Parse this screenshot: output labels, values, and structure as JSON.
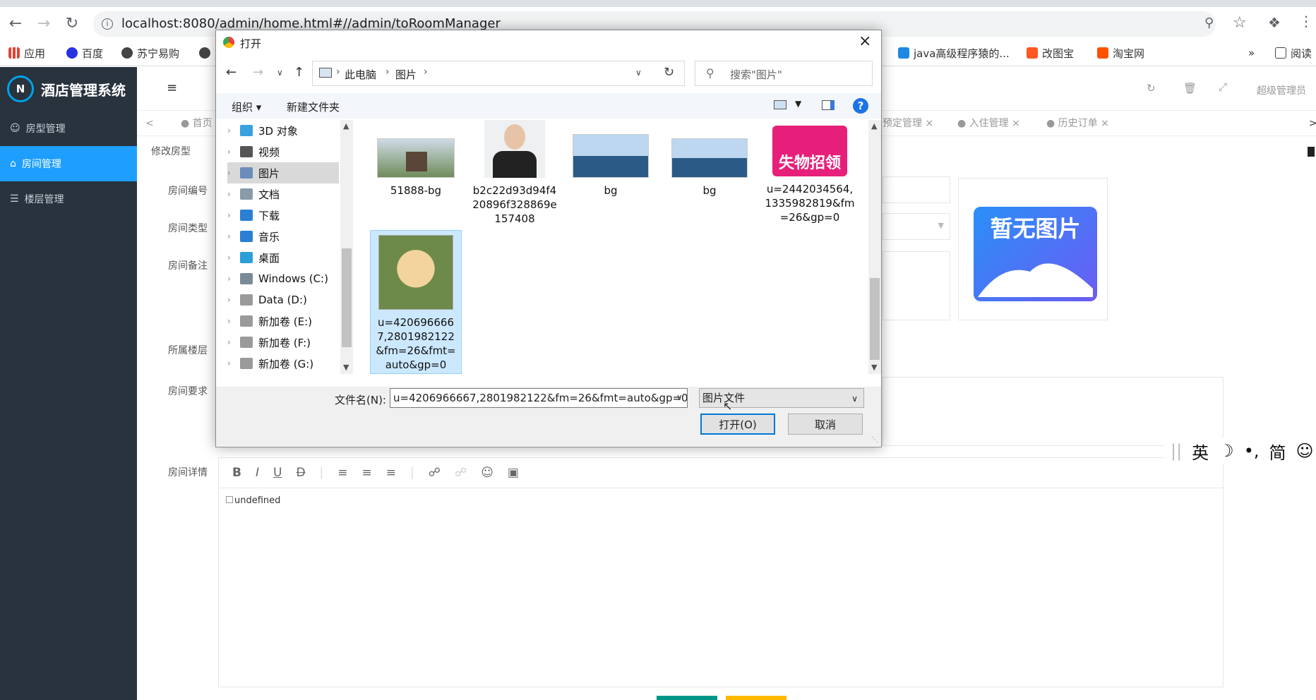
{
  "browser": {
    "url": "localhost:8080/admin/home.html#//admin/toRoomManager",
    "bookmarks": [
      {
        "label": "应用",
        "color": "#e94235"
      },
      {
        "label": "百度",
        "color": "#2932e1"
      },
      {
        "label": "苏宁易购",
        "color": "#444444"
      },
      {
        "label": "java高级程序猿的...",
        "color": "#1e88e5"
      },
      {
        "label": "改图宝",
        "color": "#ff5722"
      },
      {
        "label": "淘宝网",
        "color": "#ff5000"
      },
      {
        "label": "阅读",
        "color": "#444444"
      }
    ],
    "bookmarks_more": "»"
  },
  "app": {
    "brand": "酒店管理系统",
    "brand_logo_letter": "N",
    "menu": [
      {
        "label": "房型管理",
        "icon": "users-icon",
        "active": false
      },
      {
        "label": "房间管理",
        "icon": "home-icon",
        "active": true
      },
      {
        "label": "楼层管理",
        "icon": "list-icon",
        "active": false
      }
    ],
    "user": "超级管理员",
    "tabs": [
      {
        "label": "首页"
      },
      {
        "label": "预定管理"
      },
      {
        "label": "入住管理"
      },
      {
        "label": "历史订单"
      }
    ],
    "subtitle": "修改房型",
    "form_labels": {
      "number": "房间编号",
      "type": "房间类型",
      "remark": "房间备注",
      "floor": "所属楼层",
      "requirement": "房间要求",
      "detail": "房间详情"
    },
    "no_image_text": "暂无图片",
    "editor_content": "undefined",
    "accent": "#1e9fff",
    "sidebar_bg": "#28333e"
  },
  "ime": {
    "items": [
      "英",
      "☽",
      "•,",
      "简",
      "☺"
    ]
  },
  "dialog": {
    "title": "打开",
    "breadcrumb": [
      "此电脑",
      "图片"
    ],
    "search_placeholder": "搜索\"图片\"",
    "organize": "组织 ▾",
    "new_folder": "新建文件夹",
    "tree": [
      {
        "label": "3D 对象",
        "color": "#3aa0e0",
        "selected": false
      },
      {
        "label": "视频",
        "color": "#555555",
        "selected": false
      },
      {
        "label": "图片",
        "color": "#6b8cb8",
        "selected": true
      },
      {
        "label": "文档",
        "color": "#8a9aa8",
        "selected": false
      },
      {
        "label": "下载",
        "color": "#2a7fd4",
        "selected": false
      },
      {
        "label": "音乐",
        "color": "#2a7fd4",
        "selected": false
      },
      {
        "label": "桌面",
        "color": "#2a9fd8",
        "selected": false
      },
      {
        "label": "Windows (C:)",
        "color": "#7a8a96",
        "selected": false
      },
      {
        "label": "Data (D:)",
        "color": "#9a9a9a",
        "selected": false
      },
      {
        "label": "新加卷 (E:)",
        "color": "#9a9a9a",
        "selected": false
      },
      {
        "label": "新加卷 (F:)",
        "color": "#9a9a9a",
        "selected": false
      },
      {
        "label": "新加卷 (G:)",
        "color": "#9a9a9a",
        "selected": false
      }
    ],
    "files": [
      {
        "name": "51888-bg",
        "thumb": "house"
      },
      {
        "name": "b2c22d93d94f420896f328869e157408",
        "thumb": "portrait"
      },
      {
        "name": "bg",
        "thumb": "city"
      },
      {
        "name": "bg",
        "thumb": "city"
      },
      {
        "name": "u=2442034564,1335982819&fm=26&gp=0",
        "thumb": "poster"
      },
      {
        "name": "u=4206966667,2801982122&fm=26&fmt=auto&gp=0",
        "thumb": "puppy",
        "selected": true
      }
    ],
    "poster_text": "失物招领",
    "filename_label": "文件名(N):",
    "filename_value": "u=4206966667,2801982122&fm=26&fmt=auto&gp=0",
    "filetype": "图片文件",
    "open_label": "打开(O)",
    "cancel_label": "取消"
  }
}
